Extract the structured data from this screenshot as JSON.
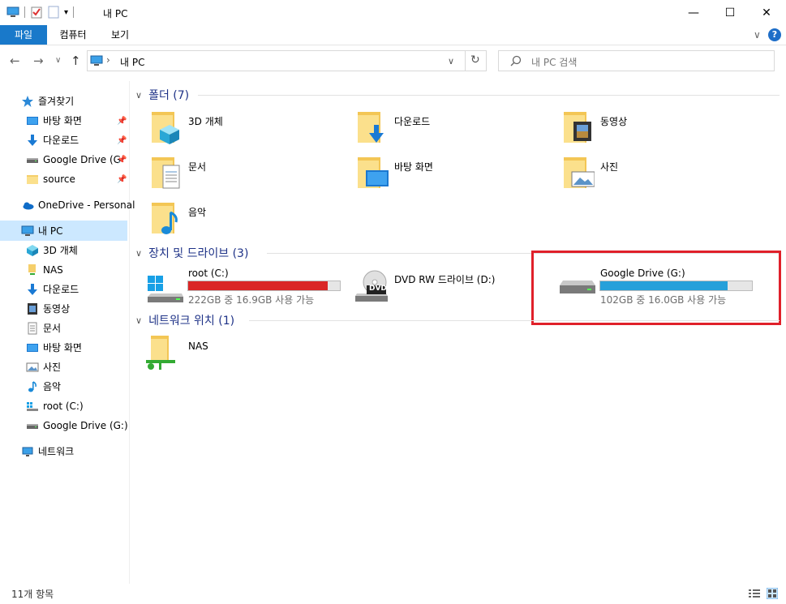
{
  "window": {
    "title": "내 PC",
    "minimize_glyph": "—",
    "maximize_glyph": "☐",
    "close_glyph": "✕",
    "qa_dropdown_glyph": "▾"
  },
  "ribbon": {
    "tabs": [
      {
        "label": "파일"
      },
      {
        "label": "컴퓨터"
      },
      {
        "label": "보기"
      }
    ],
    "expand_glyph": "∨",
    "help_glyph": "?"
  },
  "address": {
    "back_glyph": "←",
    "forward_glyph": "→",
    "recent_glyph": "∨",
    "up_glyph": "↑",
    "separator_glyph": "›",
    "path": "내 PC",
    "dropdown_glyph": "∨",
    "refresh_glyph": "↻",
    "search_placeholder": "내 PC 검색"
  },
  "sidebar": {
    "quick_access": "즐겨찾기",
    "quick_items": [
      {
        "label": "바탕 화면",
        "icon": "desktop-icon"
      },
      {
        "label": "다운로드",
        "icon": "download-icon"
      },
      {
        "label": "Google Drive (G",
        "icon": "drive-icon"
      },
      {
        "label": "source",
        "icon": "folder-icon"
      }
    ],
    "pin_glyph": "📌",
    "onedrive": "OneDrive - Personal",
    "this_pc": "내 PC",
    "pc_items": [
      {
        "label": "3D 개체",
        "icon": "3d-objects-icon"
      },
      {
        "label": "NAS",
        "icon": "network-folder-icon"
      },
      {
        "label": "다운로드",
        "icon": "download-icon"
      },
      {
        "label": "동영상",
        "icon": "video-icon"
      },
      {
        "label": "문서",
        "icon": "document-icon"
      },
      {
        "label": "바탕 화면",
        "icon": "desktop-icon"
      },
      {
        "label": "사진",
        "icon": "pictures-icon"
      },
      {
        "label": "음악",
        "icon": "music-icon"
      },
      {
        "label": "root (C:)",
        "icon": "windows-drive-icon"
      },
      {
        "label": "Google Drive (G:)",
        "icon": "drive-icon"
      }
    ],
    "network": "네트워크"
  },
  "content": {
    "folders_header": "폴더 (7)",
    "folders": [
      {
        "label": "3D 개체",
        "icon": "3d-objects-folder-icon"
      },
      {
        "label": "다운로드",
        "icon": "download-folder-icon"
      },
      {
        "label": "동영상",
        "icon": "video-folder-icon"
      },
      {
        "label": "문서",
        "icon": "document-folder-icon"
      },
      {
        "label": "바탕 화면",
        "icon": "desktop-folder-icon"
      },
      {
        "label": "사진",
        "icon": "pictures-folder-icon"
      },
      {
        "label": "음악",
        "icon": "music-folder-icon"
      }
    ],
    "drives_header": "장치 및 드라이브 (3)",
    "drives": [
      {
        "name": "root (C:)",
        "sub": "222GB 중 16.9GB 사용 가능",
        "used_fraction": 0.92,
        "bar_color": "#da2626",
        "icon": "windows-drive-icon"
      },
      {
        "name": "DVD RW 드라이브 (D:)",
        "icon": "dvd-drive-icon",
        "dvd_badge": "DVD"
      },
      {
        "name": "Google Drive (G:)",
        "sub": "102GB 중 16.0GB 사용 가능",
        "used_fraction": 0.84,
        "bar_color": "#26a0da",
        "icon": "drive-icon"
      }
    ],
    "network_header": "네트워크 위치 (1)",
    "network_items": [
      {
        "label": "NAS",
        "icon": "network-folder-icon"
      }
    ],
    "group_chevron": "∨"
  },
  "status": {
    "item_count": "11개 항목"
  },
  "colors": {
    "accent": "#1979ca",
    "highlight_box": "#e0202a",
    "selected_row": "#cce8ff"
  }
}
